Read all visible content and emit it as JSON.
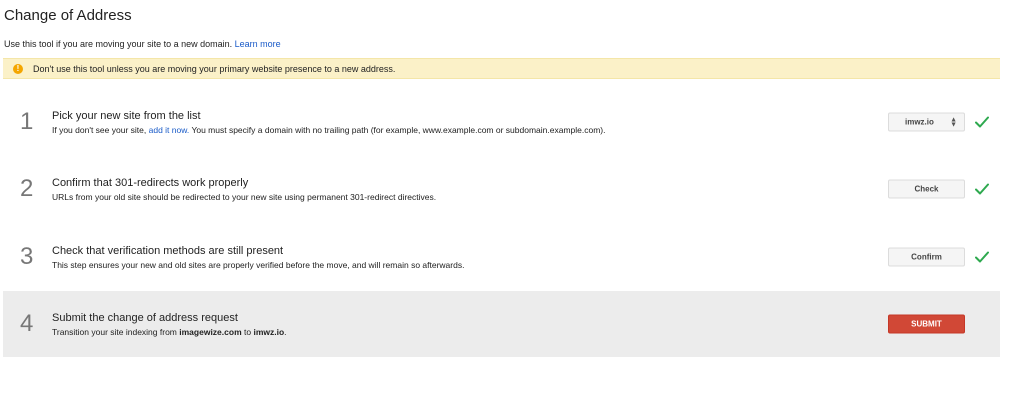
{
  "header": {
    "title": "Change of Address",
    "intro_text": "Use this tool if you are moving your site to a new domain.",
    "learn_more": "Learn more"
  },
  "warning": {
    "icon": "!",
    "text": "Don't use this tool unless you are moving your primary website presence to a new address."
  },
  "steps": [
    {
      "number": "1",
      "title": "Pick your new site from the list",
      "desc_before": "If you don't see your site,",
      "desc_link": "add it now.",
      "desc_after": "You must specify a domain with no trailing path (for example, www.example.com or subdomain.example.com).",
      "control_label": "imwz.io",
      "completed": true
    },
    {
      "number": "2",
      "title": "Confirm that 301-redirects work properly",
      "desc": "URLs from your old site should be redirected to your new site using permanent 301-redirect directives.",
      "control_label": "Check",
      "completed": true
    },
    {
      "number": "3",
      "title": "Check that verification methods are still present",
      "desc": "This step ensures your new and old sites are properly verified before the move, and will remain so afterwards.",
      "control_label": "Confirm",
      "completed": true
    },
    {
      "number": "4",
      "title": "Submit the change of address request",
      "desc_before": "Transition your site indexing from",
      "old_site": "imagewize.com",
      "desc_middle": "to",
      "new_site": "imwz.io",
      "desc_end": ".",
      "control_label": "SUBMIT",
      "completed": false
    }
  ],
  "colors": {
    "warning_bg": "#fbf1c8",
    "warning_icon": "#f4a600",
    "link": "#1a5bc8",
    "check": "#2ea94f",
    "submit": "#d14836",
    "highlight_bg": "#ececec"
  }
}
